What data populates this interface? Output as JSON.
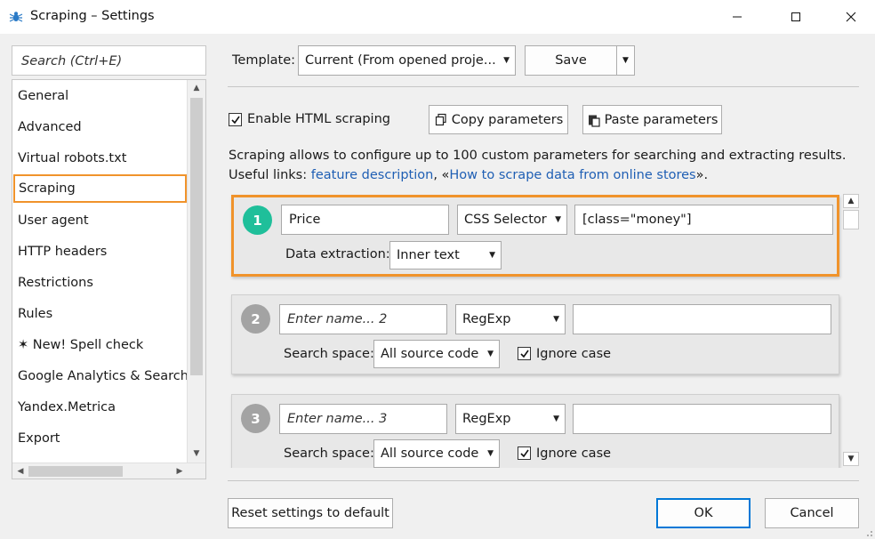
{
  "window": {
    "title": "Scraping – Settings"
  },
  "sidebar": {
    "search_placeholder": "Search (Ctrl+E)",
    "items": [
      {
        "label": "General"
      },
      {
        "label": "Advanced"
      },
      {
        "label": "Virtual robots.txt"
      },
      {
        "label": "Scraping",
        "active": true
      },
      {
        "label": "User agent"
      },
      {
        "label": "HTTP headers"
      },
      {
        "label": "Restrictions"
      },
      {
        "label": "Rules"
      },
      {
        "label": "✶ New! Spell check"
      },
      {
        "label": "Google Analytics & Search Console"
      },
      {
        "label": "Yandex.Metrica"
      },
      {
        "label": "Export"
      }
    ]
  },
  "template": {
    "label": "Template:",
    "selected": "Current (From opened proje...",
    "save_label": "Save"
  },
  "scraping": {
    "enable_label": "Enable HTML scraping",
    "enabled": true,
    "copy_label": "Copy parameters",
    "paste_label": "Paste parameters",
    "description": "Scraping allows to configure up to 100 custom parameters for searching and extracting results.",
    "links_prefix": "Useful links: ",
    "link1": "feature description",
    "links_sep": ", «",
    "link2": "How to scrape data from online stores",
    "links_suffix": "»."
  },
  "params": [
    {
      "number": "1",
      "name": "Price",
      "name_is_placeholder": false,
      "method": "CSS Selector",
      "value": "[class=\"money\"]",
      "option_label": "Data extraction:",
      "option_value": "Inner text",
      "ignore_case": null,
      "active": true,
      "circle_color": "#1fbf9a"
    },
    {
      "number": "2",
      "name": "Enter name... 2",
      "name_is_placeholder": true,
      "method": "RegExp",
      "value": "",
      "option_label": "Search space:",
      "option_value": "All source code",
      "ignore_case": "Ignore case",
      "active": false,
      "circle_color": "#a3a3a3"
    },
    {
      "number": "3",
      "name": "Enter name... 3",
      "name_is_placeholder": true,
      "method": "RegExp",
      "value": "",
      "option_label": "Search space:",
      "option_value": "All source code",
      "ignore_case": "Ignore case",
      "active": false,
      "circle_color": "#a3a3a3"
    }
  ],
  "footer": {
    "reset_label": "Reset settings to default",
    "ok_label": "OK",
    "cancel_label": "Cancel"
  },
  "colors": {
    "accent": "#f0932b",
    "link": "#1f5fb4",
    "active_step": "#1fbf9a",
    "inactive_step": "#a3a3a3",
    "default_button_border": "#0078d7"
  }
}
